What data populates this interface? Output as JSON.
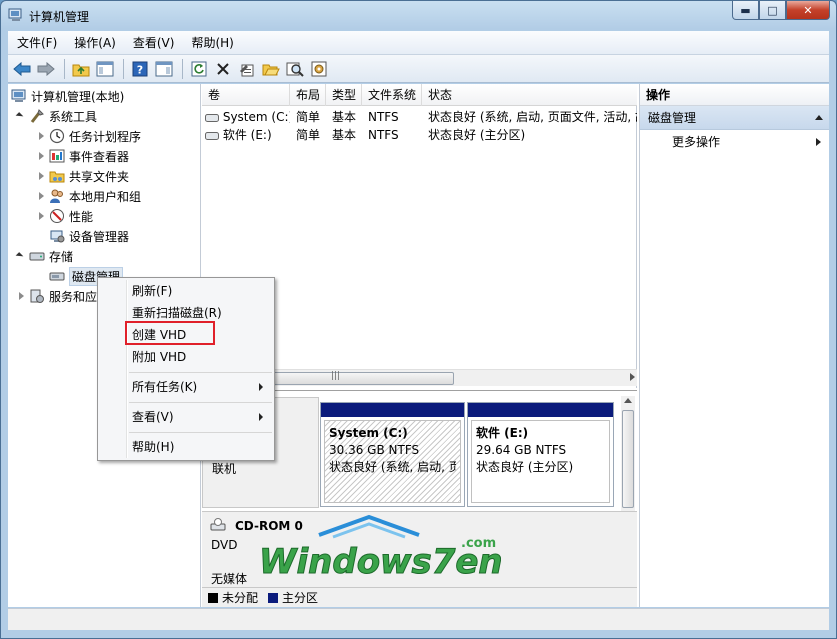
{
  "window": {
    "title": "计算机管理"
  },
  "menus": [
    "文件(F)",
    "操作(A)",
    "查看(V)",
    "帮助(H)"
  ],
  "tree": {
    "root": "计算机管理(本地)",
    "system_tools": "系统工具",
    "task_scheduler": "任务计划程序",
    "event_viewer": "事件查看器",
    "shared_folders": "共享文件夹",
    "local_users": "本地用户和组",
    "performance": "性能",
    "device_manager": "设备管理器",
    "storage": "存储",
    "disk_management": "磁盘管理",
    "services": "服务和应"
  },
  "volume_table": {
    "headers": [
      "卷",
      "布局",
      "类型",
      "文件系统",
      "状态"
    ],
    "rows": [
      {
        "volume": "System (C:)",
        "layout": "简单",
        "type": "基本",
        "fs": "NTFS",
        "status": "状态良好 (系统, 启动, 页面文件, 活动, 故"
      },
      {
        "volume": "软件 (E:)",
        "layout": "简单",
        "type": "基本",
        "fs": "NTFS",
        "status": "状态良好 (主分区)"
      }
    ]
  },
  "disk0": {
    "status": "联机",
    "partitions": [
      {
        "name": "System  (C:)",
        "size": "30.36 GB NTFS",
        "status": "状态良好 (系统, 启动, 页"
      },
      {
        "name": "软件  (E:)",
        "size": "29.64 GB NTFS",
        "status": "状态良好 (主分区)"
      }
    ]
  },
  "cdrom": {
    "name": "CD-ROM 0",
    "type": "DVD",
    "status": "无媒体"
  },
  "legend": {
    "unallocated": "未分配",
    "primary": "主分区"
  },
  "actions": {
    "header": "操作",
    "section": "磁盘管理",
    "more": "更多操作"
  },
  "context_menu": {
    "refresh": "刷新(F)",
    "rescan": "重新扫描磁盘(R)",
    "create_vhd": "创建 VHD",
    "attach_vhd": "附加 VHD",
    "all_tasks": "所有任务(K)",
    "view": "查看(V)",
    "help": "帮助(H)"
  },
  "watermark": {
    "text": "Windows7en",
    "suffix": ".com"
  },
  "colors": {
    "primary_partition": "#0b1b7c",
    "unallocated": "#000000",
    "highlight": "#e0202a"
  }
}
